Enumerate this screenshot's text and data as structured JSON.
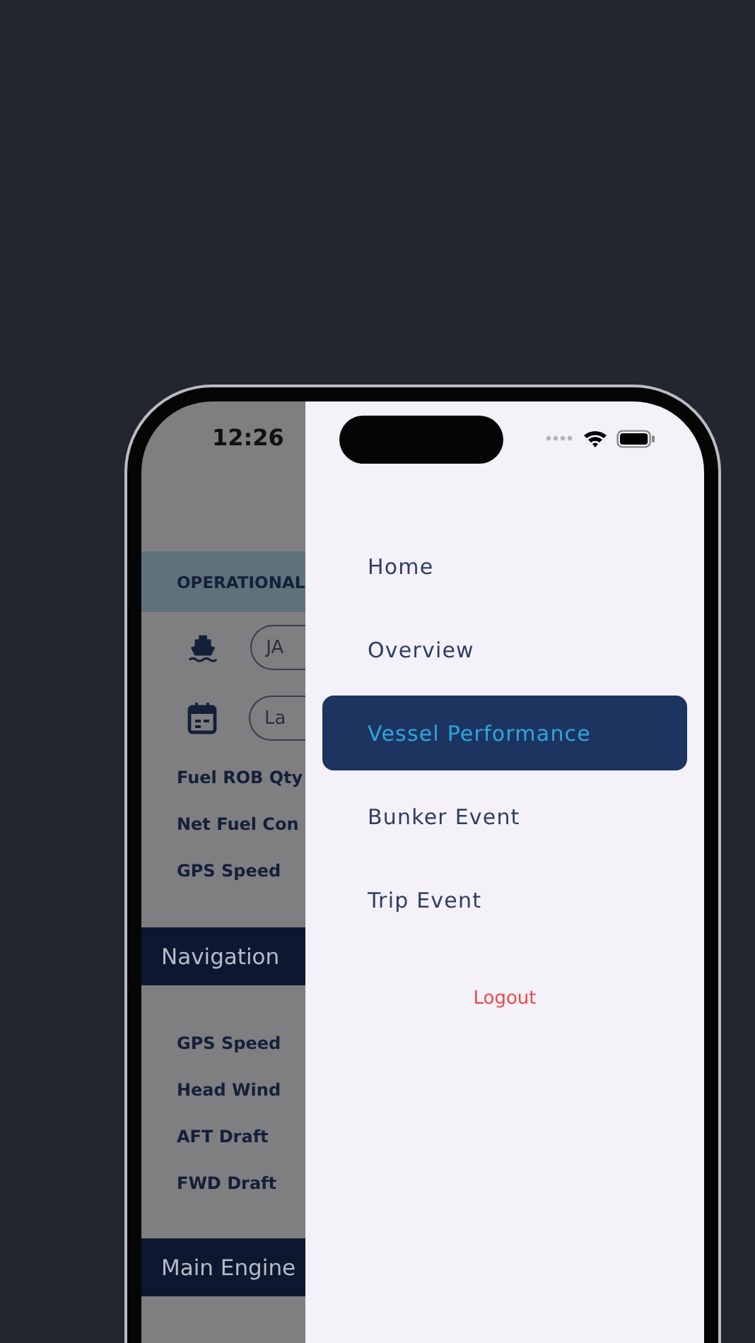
{
  "status_bar": {
    "time": "12:26"
  },
  "background_screen": {
    "header": "OPERATIONAL",
    "filters": [
      {
        "kind": "vessel",
        "value": "JA"
      },
      {
        "kind": "date",
        "value": "La"
      }
    ],
    "fields": [
      "Fuel ROB Qty",
      "Net Fuel Con",
      "GPS Speed"
    ],
    "sections": [
      {
        "title": "Navigation",
        "rows": [
          "GPS Speed",
          "Head Wind",
          "AFT Draft",
          "FWD Draft"
        ]
      },
      {
        "title": "Main Engine"
      }
    ]
  },
  "drawer": {
    "items": [
      {
        "label": "Home",
        "selected": false
      },
      {
        "label": "Overview",
        "selected": false
      },
      {
        "label": "Vessel Performance",
        "selected": true
      },
      {
        "label": "Bunker Event",
        "selected": false
      },
      {
        "label": "Trip Event",
        "selected": false
      }
    ],
    "logout": "Logout"
  }
}
